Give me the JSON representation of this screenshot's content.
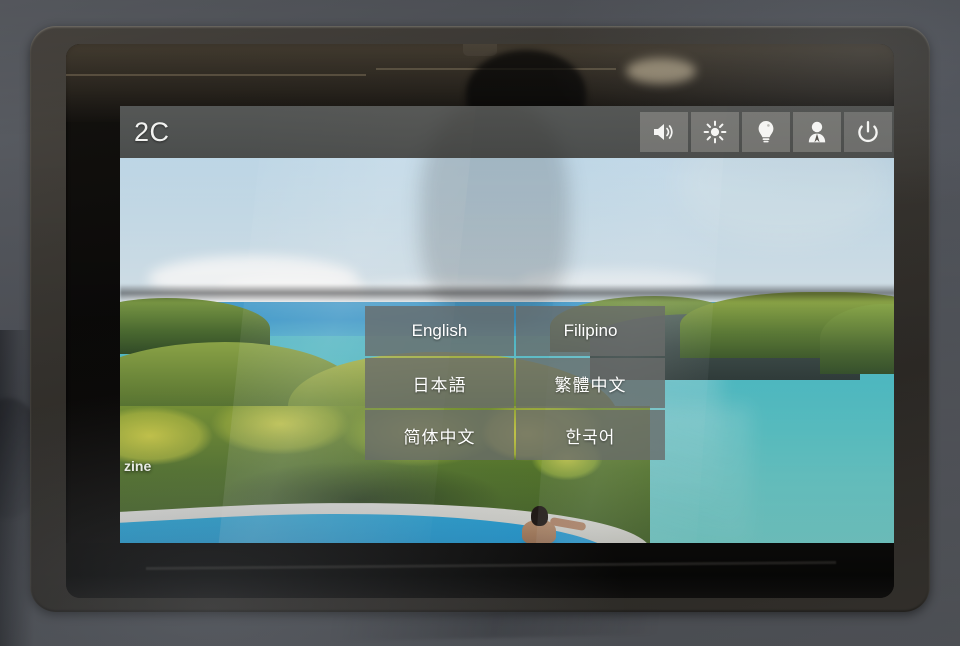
{
  "device": {
    "type": "aircraft-seatback-ife-screen",
    "bezel_color": "#3b3833",
    "seatback_color": "#55585e"
  },
  "header": {
    "seat_label": "2C",
    "background_color": "#3a3630",
    "icons": [
      {
        "name": "volume-icon",
        "label": "Volume"
      },
      {
        "name": "brightness-icon",
        "label": "Brightness"
      },
      {
        "name": "reading-light-icon",
        "label": "Reading Light"
      },
      {
        "name": "attendant-call-icon",
        "label": "Flight Attendant Call"
      },
      {
        "name": "power-icon",
        "label": "Power"
      }
    ]
  },
  "language_menu": {
    "button_color": "#696b6a",
    "text_color": "#ffffff",
    "options": [
      {
        "id": "english",
        "label": "English"
      },
      {
        "id": "filipino",
        "label": "Filipino"
      },
      {
        "id": "japanese",
        "label": "日本語"
      },
      {
        "id": "traditional-chinese",
        "label": "繁體中文"
      },
      {
        "id": "simplified-chinese",
        "label": "简体中文"
      },
      {
        "id": "korean",
        "label": "한국어"
      }
    ]
  },
  "wallpaper": {
    "caption": "zine",
    "description": "tropical lagoon with infinity pool",
    "sky_color": "#c6dce9",
    "lagoon_color": "#5fcdd0",
    "pool_color": "#2aa7e2",
    "foliage_color": "#8ba93a"
  }
}
